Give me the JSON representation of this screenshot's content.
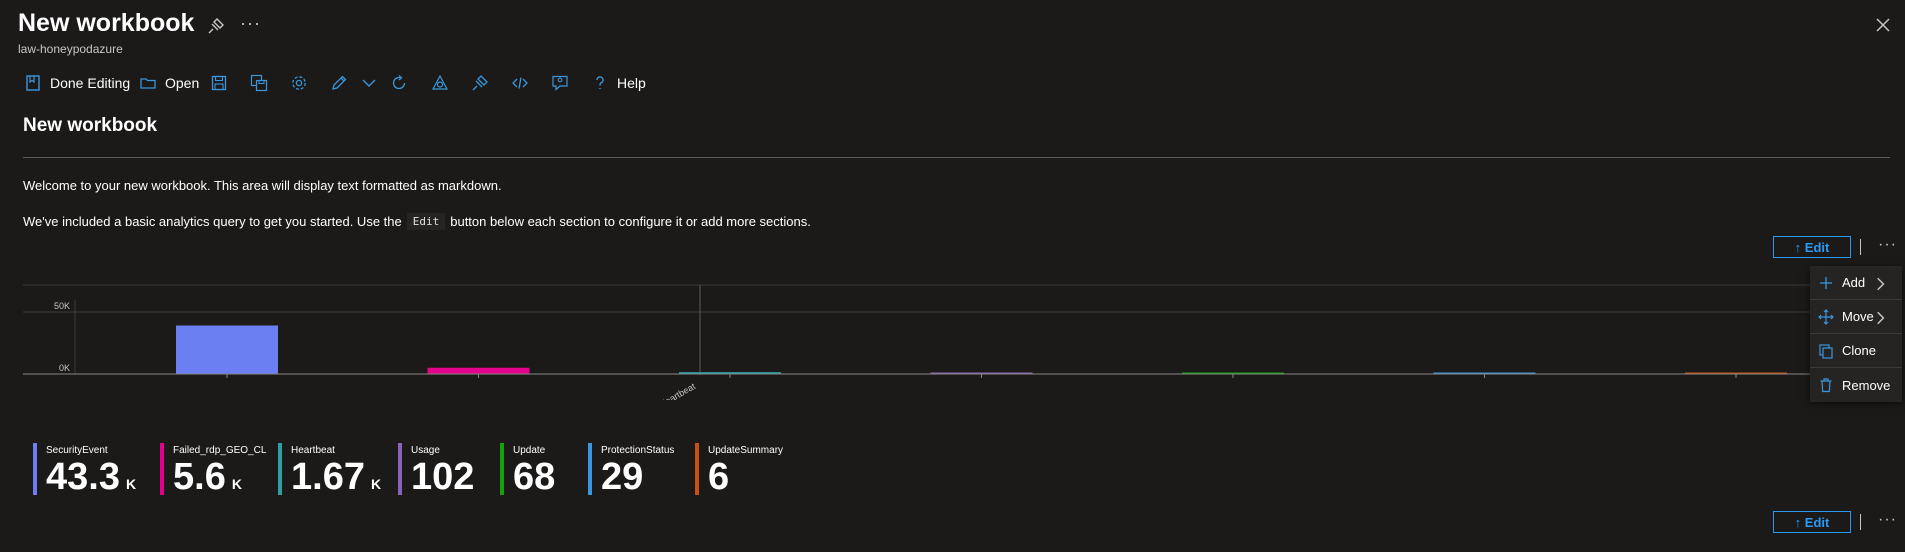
{
  "header": {
    "title": "New workbook",
    "subtitle": "law-honeypodazure",
    "more": "···"
  },
  "toolbar": {
    "done_editing": "Done Editing",
    "open": "Open",
    "help": "Help"
  },
  "content": {
    "section_title": "New workbook",
    "paragraph1": "Welcome to your new workbook. This area will display text formatted as markdown.",
    "paragraph2_before": "We've included a basic analytics query to get you started. Use the",
    "paragraph2_code": "Edit",
    "paragraph2_after": "button below each section to configure it or add more sections."
  },
  "edit_button": "↑ Edit",
  "section_more": "···",
  "context_menu": {
    "add": "Add",
    "move": "Move",
    "clone": "Clone",
    "remove": "Remove"
  },
  "chart_data": {
    "type": "bar",
    "categories": [
      "SecurityEvent",
      "Failed_rdp_GEO_CL",
      "Heartbeat",
      "Usage",
      "Update",
      "ProtectionStatus",
      "UpdateSummary"
    ],
    "values": [
      43300,
      5600,
      1670,
      102,
      68,
      29,
      6
    ],
    "colors": [
      "#6b7ff2",
      "#e3008c",
      "#2aa0a4",
      "#8764b8",
      "#13a10e",
      "#3a96dd",
      "#ca5010"
    ],
    "y_ticks": [
      "50K",
      "0K"
    ],
    "ylim": [
      -2000,
      70000
    ],
    "visible_x_label": "Heartbeat",
    "grid": true
  },
  "tiles": [
    {
      "label": "SecurityEvent",
      "value": "43.3",
      "unit": "K",
      "color": "#6b7ff2"
    },
    {
      "label": "Failed_rdp_GEO_CL",
      "value": "5.6",
      "unit": "K",
      "color": "#e3008c"
    },
    {
      "label": "Heartbeat",
      "value": "1.67",
      "unit": "K",
      "color": "#2aa0a4"
    },
    {
      "label": "Usage",
      "value": "102",
      "unit": "",
      "color": "#8764b8"
    },
    {
      "label": "Update",
      "value": "68",
      "unit": "",
      "color": "#13a10e"
    },
    {
      "label": "ProtectionStatus",
      "value": "29",
      "unit": "",
      "color": "#3a96dd"
    },
    {
      "label": "UpdateSummary",
      "value": "6",
      "unit": "",
      "color": "#ca5010"
    }
  ]
}
